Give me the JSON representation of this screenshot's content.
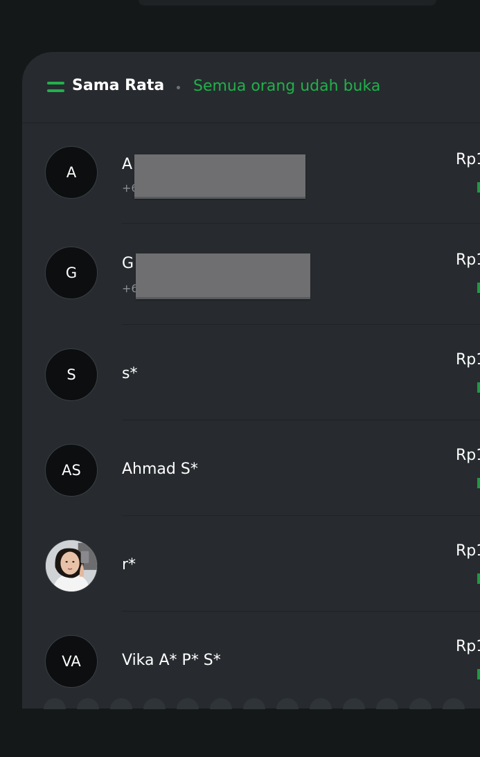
{
  "header": {
    "title": "Sama Rata",
    "status": "Semua orang udah buka",
    "icon": "split-equal-icon",
    "status_color": "#20b14a"
  },
  "participants": [
    {
      "initials": "A",
      "name": "A",
      "phone": "+6",
      "amount": "Rp1",
      "redacted": true
    },
    {
      "initials": "G",
      "name": "G",
      "phone": "+6",
      "amount": "Rp1",
      "redacted": true
    },
    {
      "initials": "S",
      "name": "s*",
      "amount": "Rp1"
    },
    {
      "initials": "AS",
      "name": "Ahmad S*",
      "amount": "Rp1"
    },
    {
      "initials": "",
      "name": "r*",
      "amount": "Rp1",
      "photo": true
    },
    {
      "initials": "VA",
      "name": "Vika A* P* S*",
      "amount": "Rp1"
    }
  ]
}
